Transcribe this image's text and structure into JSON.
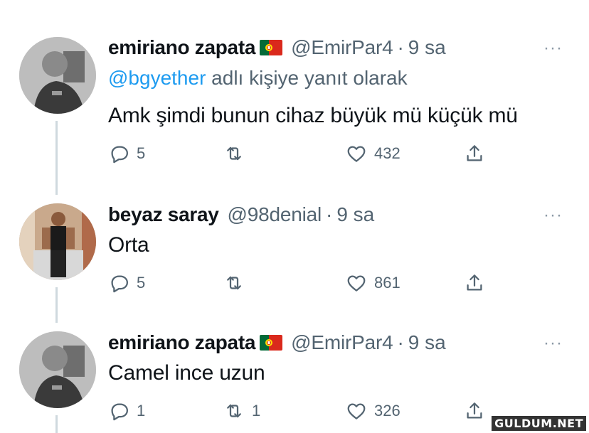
{
  "tweets": [
    {
      "name": "emiriano zapata",
      "has_flag": true,
      "handle": "@EmirPar4",
      "separator": "·",
      "time": "9 sa",
      "reply_mention": "@bgyether",
      "reply_suffix": " adlı kişiye yanıt olarak",
      "text": "Amk şimdi bunun cihaz büyük mü küçük mü",
      "replies": "5",
      "retweets": "",
      "likes": "432",
      "more": "···"
    },
    {
      "name": "beyaz saray",
      "has_flag": false,
      "handle": "@98denial",
      "separator": "·",
      "time": "9 sa",
      "text": "Orta",
      "replies": "5",
      "retweets": "",
      "likes": "861",
      "more": "···"
    },
    {
      "name": "emiriano zapata",
      "has_flag": true,
      "handle": "@EmirPar4",
      "separator": "·",
      "time": "9 sa",
      "text": "Camel ince uzun",
      "replies": "1",
      "retweets": "1",
      "likes": "326",
      "more": "···"
    }
  ],
  "icons": {
    "reply": "reply-icon",
    "retweet": "retweet-icon",
    "like": "heart-icon",
    "share": "share-icon",
    "flag": "portugal-flag-icon"
  },
  "colors": {
    "text": "#0f1419",
    "secondary": "#536471",
    "link": "#1d9bf0",
    "flag_green": "#046a38",
    "flag_red": "#da291c"
  },
  "watermark": "GULDUM.NET"
}
